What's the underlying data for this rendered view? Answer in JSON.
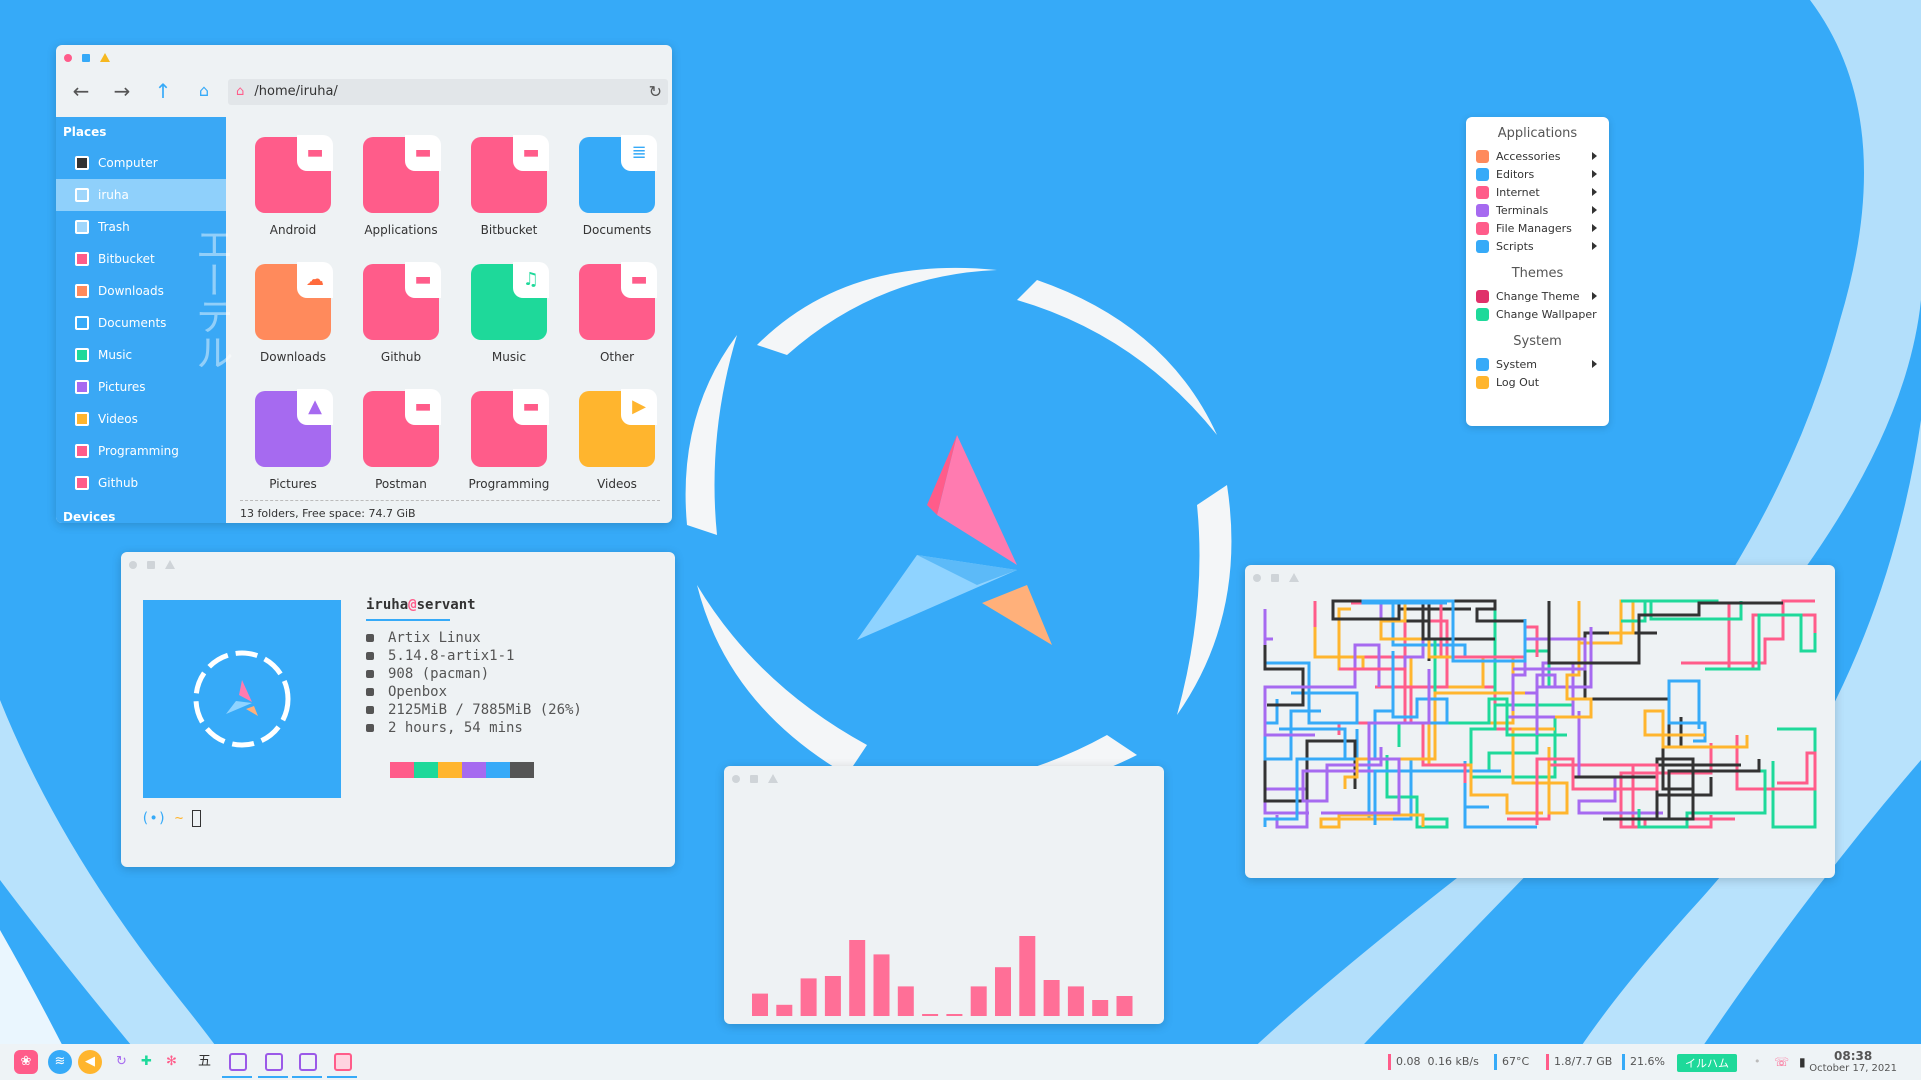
{
  "file_manager": {
    "path": "/home/iruha/",
    "places_heading": "Places",
    "devices_heading": "Devices",
    "watermark": "エーテル",
    "sidebar": [
      {
        "label": "Computer",
        "icon": "computer-icon",
        "color": "#333333"
      },
      {
        "label": "iruha",
        "icon": "home-icon",
        "color": "#9fd6fb",
        "active": true
      },
      {
        "label": "Trash",
        "icon": "trash-icon",
        "color": "#9fd6fb"
      },
      {
        "label": "Bitbucket",
        "icon": "folder-icon",
        "color": "#ff5c8a"
      },
      {
        "label": "Downloads",
        "icon": "download-icon",
        "color": "#ff8a5c"
      },
      {
        "label": "Documents",
        "icon": "document-icon",
        "color": "#36aaf8"
      },
      {
        "label": "Music",
        "icon": "music-icon",
        "color": "#1ed99a"
      },
      {
        "label": "Pictures",
        "icon": "picture-icon",
        "color": "#a66af0"
      },
      {
        "label": "Videos",
        "icon": "video-icon",
        "color": "#ffb52e"
      },
      {
        "label": "Programming",
        "icon": "folder-icon",
        "color": "#ff5c8a"
      },
      {
        "label": "Github",
        "icon": "folder-icon",
        "color": "#ff5c8a"
      }
    ],
    "folders": [
      {
        "label": "Android",
        "color": "#ff5c8a",
        "badge": "▬",
        "badge_color": "#ff5c8a"
      },
      {
        "label": "Applications",
        "color": "#ff5c8a",
        "badge": "▬",
        "badge_color": "#ff5c8a"
      },
      {
        "label": "Bitbucket",
        "color": "#ff5c8a",
        "badge": "▬",
        "badge_color": "#ff5c8a"
      },
      {
        "label": "Documents",
        "color": "#36aaf8",
        "badge": "≣",
        "badge_color": "#36aaf8"
      },
      {
        "label": "Downloads",
        "color": "#ff8a5c",
        "badge": "☁",
        "badge_color": "#ff6a3c"
      },
      {
        "label": "Github",
        "color": "#ff5c8a",
        "badge": "▬",
        "badge_color": "#ff5c8a"
      },
      {
        "label": "Music",
        "color": "#1ed99a",
        "badge": "♫",
        "badge_color": "#1ed99a"
      },
      {
        "label": "Other",
        "color": "#ff5c8a",
        "badge": "▬",
        "badge_color": "#ff5c8a"
      },
      {
        "label": "Pictures",
        "color": "#a66af0",
        "badge": "▲",
        "badge_color": "#a66af0"
      },
      {
        "label": "Postman",
        "color": "#ff5c8a",
        "badge": "▬",
        "badge_color": "#ff5c8a"
      },
      {
        "label": "Programming",
        "color": "#ff5c8a",
        "badge": "▬",
        "badge_color": "#ff5c8a"
      },
      {
        "label": "Videos",
        "color": "#ffb52e",
        "badge": "▶",
        "badge_color": "#ffb52e"
      }
    ],
    "status": "13 folders, Free space: 74.7 GiB"
  },
  "neofetch": {
    "user": "iruha",
    "at": "@",
    "host": "servant",
    "lines": [
      "Artix Linux",
      "5.14.8-artix1-1",
      "908 (pacman)",
      "Openbox",
      "2125MiB / 7885MiB (26%)",
      "2 hours, 54 mins"
    ],
    "palette": [
      "#eef2f4",
      "#ff5c8a",
      "#1ed99a",
      "#ffb52e",
      "#a66af0",
      "#36aaf8",
      "#555555"
    ],
    "prompt_symbol": "(•)",
    "prompt_path": "~"
  },
  "visualizer": {
    "levels": [
      0.28,
      0.14,
      0.47,
      0.5,
      0.95,
      0.77,
      0.37,
      0.02,
      0.02,
      0.37,
      0.61,
      1.0,
      0.45,
      0.37,
      0.2,
      0.25
    ]
  },
  "menu": {
    "sections": [
      {
        "heading": "Applications",
        "items": [
          {
            "label": "Accessories",
            "color": "#ff8a5c",
            "submenu": true
          },
          {
            "label": "Editors",
            "color": "#36aaf8",
            "submenu": true
          },
          {
            "label": "Internet",
            "color": "#ff5c8a",
            "submenu": true
          },
          {
            "label": "Terminals",
            "color": "#a66af0",
            "submenu": true
          },
          {
            "label": "File Managers",
            "color": "#ff5c8a",
            "submenu": true
          },
          {
            "label": "Scripts",
            "color": "#36aaf8",
            "submenu": true
          }
        ]
      },
      {
        "heading": "Themes",
        "items": [
          {
            "label": "Change Theme",
            "color": "#e0306a",
            "submenu": true
          },
          {
            "label": "Change Wallpaper",
            "color": "#1ed99a",
            "submenu": false
          }
        ]
      },
      {
        "heading": "System",
        "items": [
          {
            "label": "System",
            "color": "#36aaf8",
            "submenu": true
          },
          {
            "label": "Log Out",
            "color": "#ffb52e",
            "submenu": false
          }
        ]
      }
    ]
  },
  "taskbar": {
    "workspace_label": "五",
    "net_down": "0.08",
    "net_up": "0.16 kB/s",
    "temperature": "67°C",
    "disk": "1.8/7.7 GB",
    "cpu": "21.6%",
    "tag": "イルハム",
    "time": "08:38",
    "date": "October 17, 2021"
  },
  "colors": {
    "accent": "#36aaf8",
    "pink": "#ff5c8a",
    "green": "#1ed99a",
    "orange": "#ffb52e",
    "purple": "#a66af0"
  }
}
